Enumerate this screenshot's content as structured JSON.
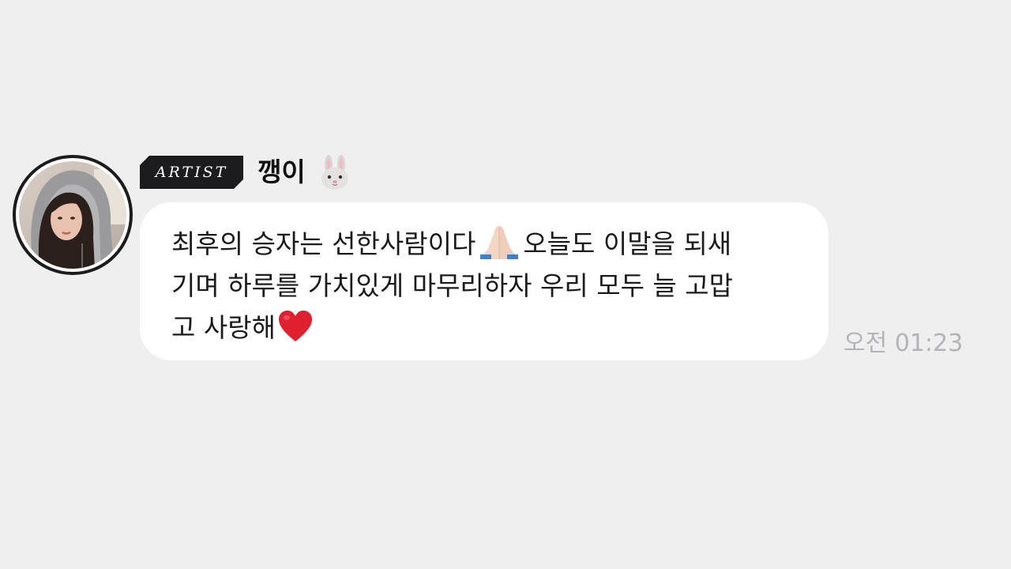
{
  "artist_badge": "ARTIST",
  "sender": {
    "name": "깽이",
    "name_icon": "rabbit-face-icon"
  },
  "message": {
    "line1_text": "최후의 승자는 선한사람이다",
    "line1_emoji": "folded-hands-icon",
    "line1_text_after": "오늘도 이말을 되새",
    "line2_text": "기며 하루를 가치있게 마무리하자 우리 모두 늘 고맙",
    "line3_text": "고 사랑해",
    "line3_emoji": "red-heart-icon"
  },
  "timestamp": "오전 01:23",
  "colors": {
    "background": "#efeff0",
    "bubble": "#ffffff",
    "badge": "#1c1c1e",
    "timestamp": "#b4b4b8",
    "heart": "#e0202e"
  }
}
